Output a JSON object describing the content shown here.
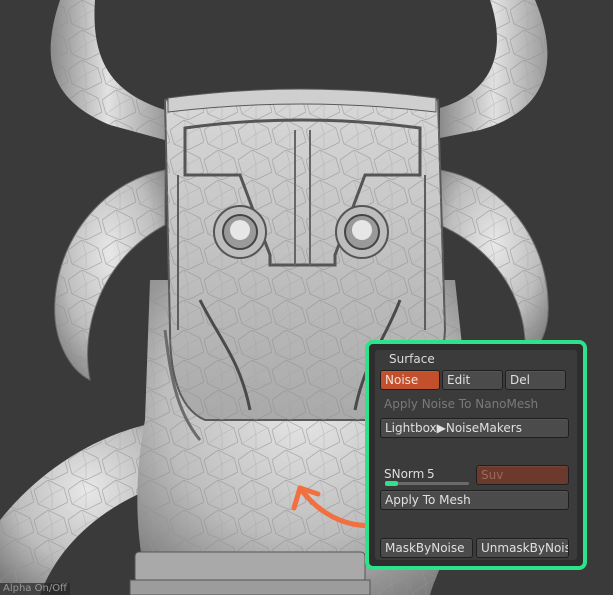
{
  "colors": {
    "accent": "#2de28a",
    "active_button": "#c2502c",
    "annotation_arrow": "#f07040"
  },
  "panel": {
    "title": "Surface",
    "buttons": {
      "noise": "Noise",
      "edit": "Edit",
      "del": "Del"
    },
    "apply_nano": "Apply Noise To NanoMesh",
    "lightbox": "Lightbox▶NoiseMakers",
    "snorm": {
      "label": "SNorm",
      "value": "5",
      "level_fraction": 0.15
    },
    "suv": "Suv",
    "apply_mesh": "Apply To Mesh",
    "mask": "MaskByNoise",
    "unmask": "UnmaskByNoise"
  },
  "footer": {
    "text": "Alpha On/Off"
  }
}
